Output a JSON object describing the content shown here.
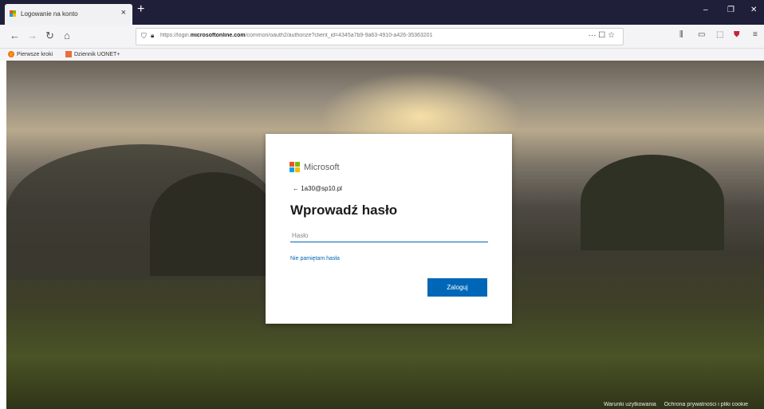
{
  "browser": {
    "tab_title": "Logowanie na konto",
    "tab_close": "×",
    "new_tab": "+",
    "window_controls": [
      "–",
      "❐",
      "✕"
    ],
    "nav": {
      "back": "←",
      "forward": "→",
      "reload": "↻",
      "home": "⌂"
    },
    "url_prefix": "https://login.",
    "url_host": "microsoftonline.com",
    "url_rest": "/common/oauth2/authorize?client_id=4345a7b9-9a63-4910-a426-35363201",
    "url_icons": "··· ☐ ☆",
    "right_icons": [
      "⫼",
      "▭",
      "⬚",
      "⛊",
      "≡"
    ],
    "bookmarks": [
      {
        "label": "Pierwsze kroki",
        "icon": "firefox-icon"
      },
      {
        "label": "Dziennik UONET+",
        "icon": "bookmark-icon"
      }
    ]
  },
  "login": {
    "brand": "Microsoft",
    "identity": "← 1a30@sp10.pl",
    "heading": "Wprowadź hasło",
    "password_placeholder": "Hasło",
    "forgot_link": "Nie pamiętam hasła",
    "signin_label": "Zaloguj"
  },
  "footer": {
    "terms": "Warunki użytkowania",
    "privacy": "Ochrona prywatności i pliki cookie"
  },
  "colors": {
    "accent": "#0067b8",
    "tabbar": "#1f1f3a"
  }
}
